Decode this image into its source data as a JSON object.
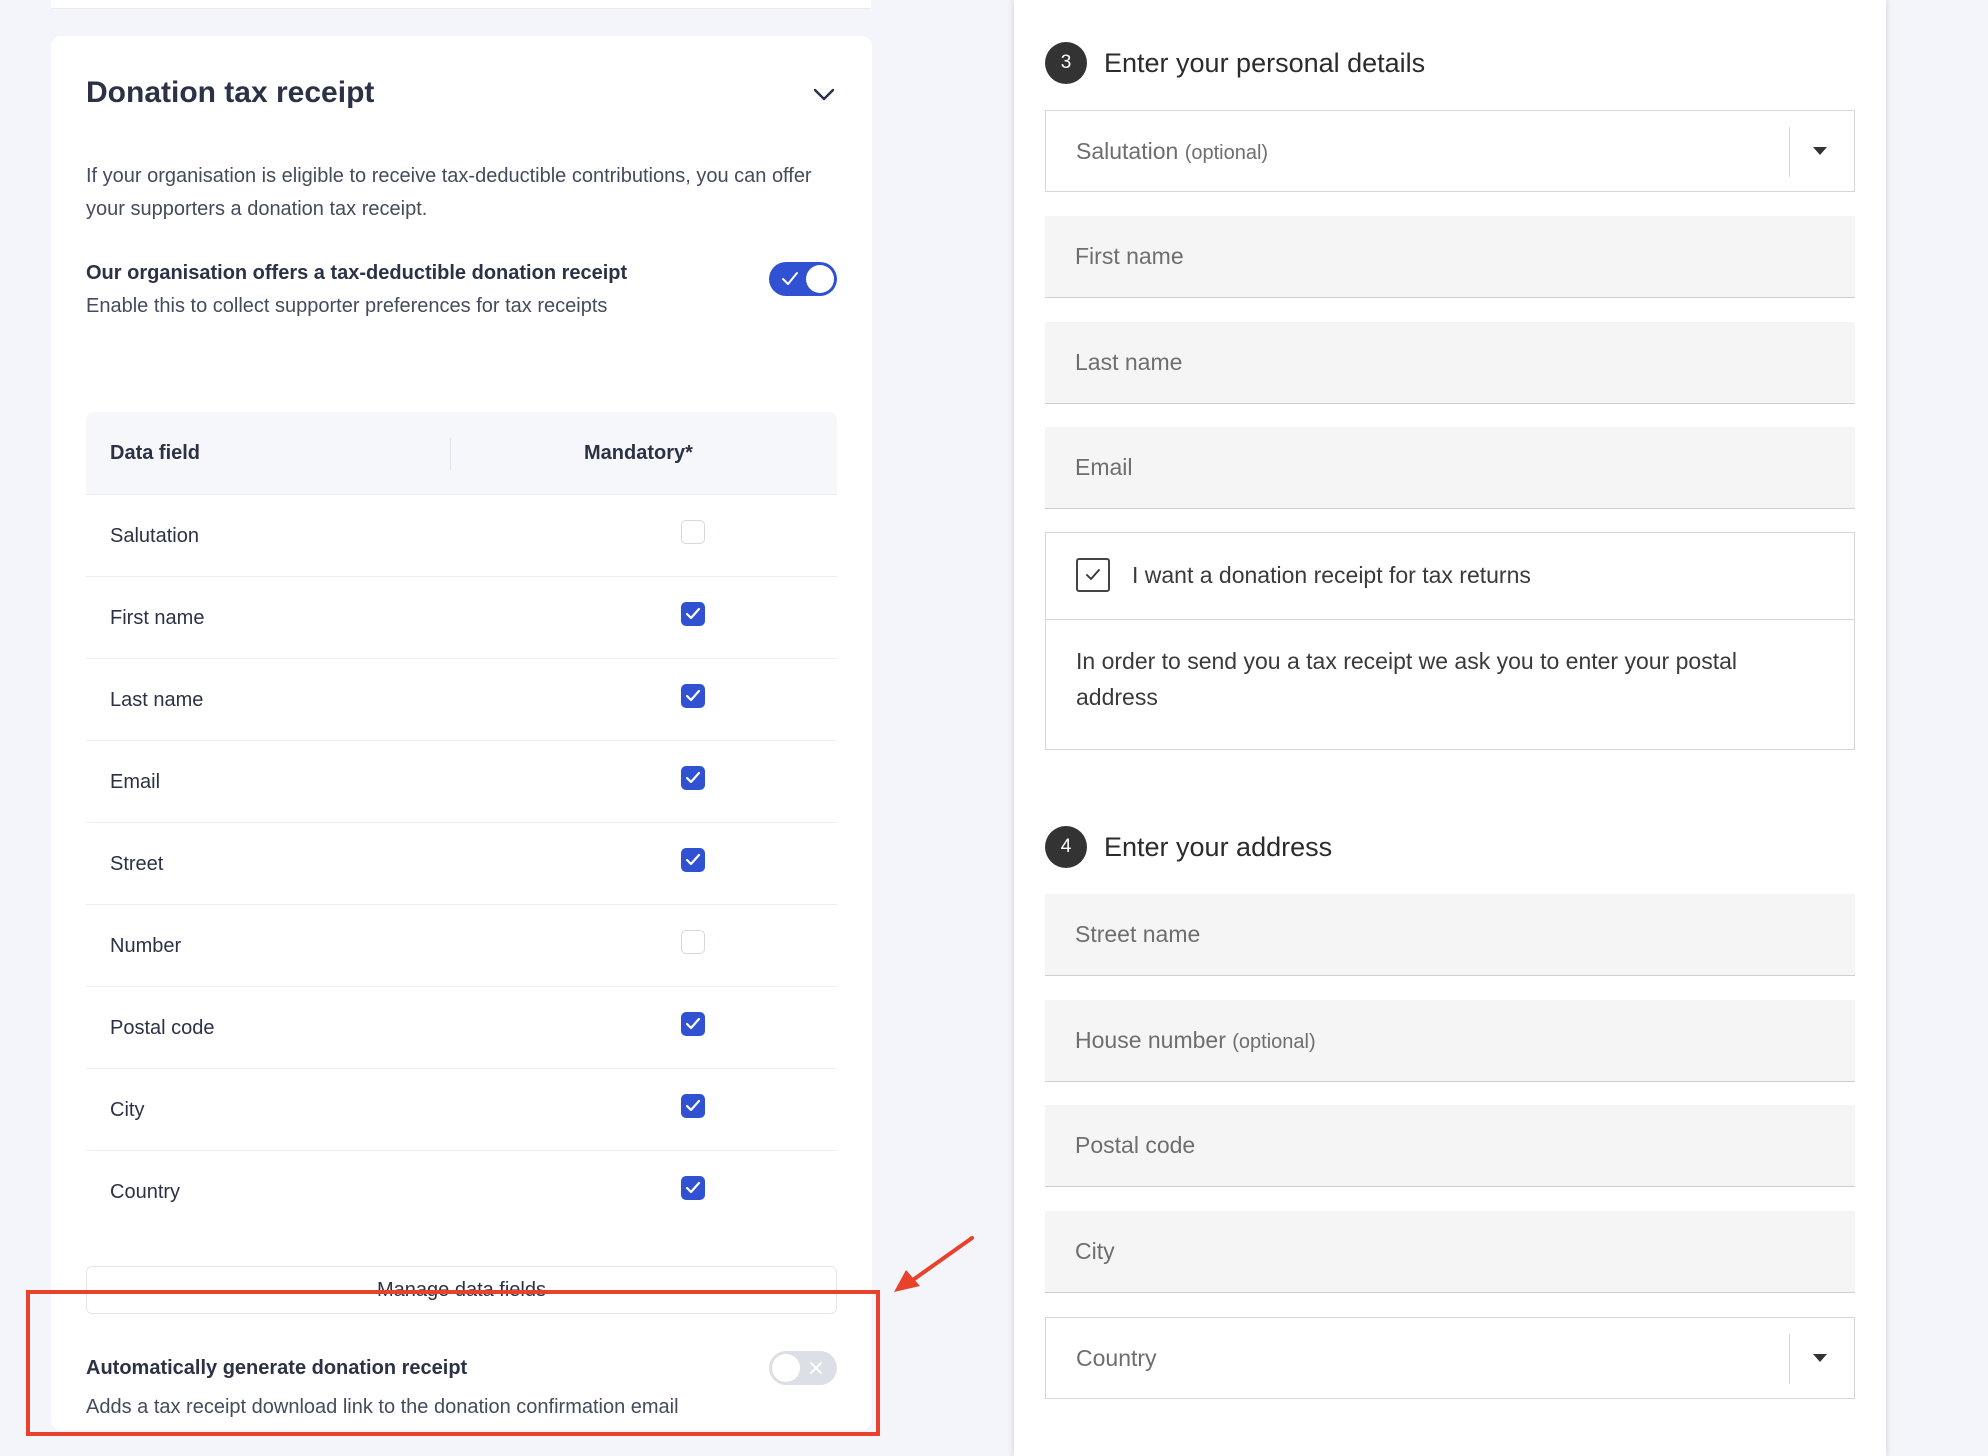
{
  "settings": {
    "title": "Donation tax receipt",
    "intro": "If your organisation is eligible to receive tax-deductible contributions, you can offer your supporters a donation tax receipt.",
    "offer_toggle": {
      "title": "Our organisation offers a tax-deductible donation receipt",
      "subtitle": "Enable this to collect supporter preferences for tax receipts",
      "on": true
    },
    "table": {
      "col_field": "Data field",
      "col_mandatory": "Mandatory*",
      "rows": [
        {
          "label": "Salutation",
          "mandatory": false
        },
        {
          "label": "First name",
          "mandatory": true
        },
        {
          "label": "Last name",
          "mandatory": true
        },
        {
          "label": "Email",
          "mandatory": true
        },
        {
          "label": "Street",
          "mandatory": true
        },
        {
          "label": "Number",
          "mandatory": false
        },
        {
          "label": "Postal code",
          "mandatory": true
        },
        {
          "label": "City",
          "mandatory": true
        },
        {
          "label": "Country",
          "mandatory": true
        }
      ]
    },
    "manage_button": "Manage data fields",
    "auto_toggle": {
      "title": "Automatically generate donation receipt",
      "subtitle": "Adds a tax receipt download link to the donation confirmation email",
      "on": false
    }
  },
  "preview": {
    "step3": {
      "number": "3",
      "title": "Enter your personal details",
      "salutation": {
        "placeholder": "Salutation",
        "optional": "(optional)"
      },
      "first_name": "First name",
      "last_name": "Last name",
      "email": "Email",
      "receipt_checkbox": {
        "label": "I want a donation receipt for tax returns",
        "checked": true
      },
      "receipt_note": "In order to send you a tax receipt we ask you to enter your postal address"
    },
    "step4": {
      "number": "4",
      "title": "Enter your address",
      "street": "Street name",
      "house_number": {
        "placeholder": "House number",
        "optional": "(optional)"
      },
      "postal_code": "Postal code",
      "city": "City",
      "country": "Country"
    }
  },
  "colors": {
    "accent": "#3151d3",
    "highlight": "#e8412c",
    "badge": "#333333"
  },
  "icons": [
    "chevron-down-icon",
    "check-icon",
    "close-icon",
    "caret-down-icon",
    "arrow-annotation-icon"
  ]
}
